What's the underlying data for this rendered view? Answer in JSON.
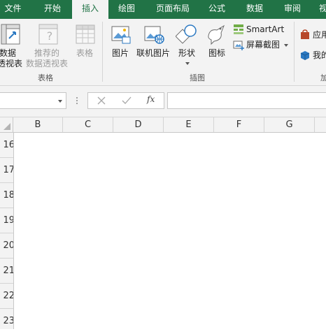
{
  "ribbon_tabs": [
    "文件",
    "开始",
    "插入",
    "绘图",
    "页面布局",
    "公式",
    "数据",
    "审阅",
    "视"
  ],
  "active_tab": "插入",
  "tables_group": {
    "label": "表格",
    "pivot_line1": "数据",
    "pivot_line2": "透视表",
    "recommended_line1": "推荐的",
    "recommended_line2": "数据透视表",
    "table": "表格"
  },
  "illustrations_group": {
    "label": "插图",
    "picture": "图片",
    "online_picture": "联机图片",
    "shapes": "形状",
    "icons": "图标",
    "smartart": "SmartArt",
    "screenshot": "屏幕截图"
  },
  "addins_group": {
    "label": "加",
    "store": "应用",
    "my_addins": "我的"
  },
  "formula_bar": {
    "fx_label": "fx",
    "name_box_value": "",
    "formula_value": ""
  },
  "columns": [
    "B",
    "C",
    "D",
    "E",
    "F",
    "G"
  ],
  "rows": [
    "16",
    "17",
    "18",
    "19",
    "20",
    "21",
    "22",
    "23"
  ],
  "colors": {
    "accent": "#217346",
    "ribbon_bg": "#f3f3f3"
  }
}
